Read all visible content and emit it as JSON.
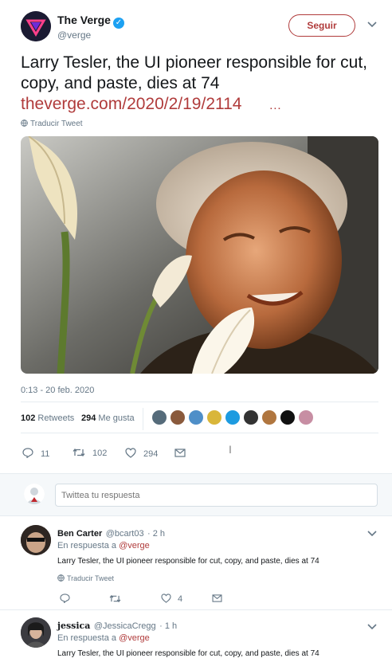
{
  "author": {
    "name": "The Verge",
    "handle": "@verge",
    "verified_mark": "✓",
    "follow_label": "Seguir",
    "menu_chevron": "⌄"
  },
  "tweet": {
    "text": "Larry Tesler, the UI pioneer responsible for cut, copy, and paste, dies at 74",
    "link": "theverge.com/2020/2/19/2114",
    "ellipsis": "…",
    "translate": "Traducir Tweet",
    "datetime": "0:13 - 20 feb. 2020",
    "retweets_count": "102",
    "retweets_label": "Retweets",
    "likes_count": "294",
    "likes_label": "Me gusta"
  },
  "actions": {
    "reply_count": "11",
    "retweet_count": "102",
    "like_count": "294"
  },
  "reply_box": {
    "placeholder": "Twittea tu respuesta"
  },
  "replies": [
    {
      "name": "Ben Carter",
      "handle": "@bcart03",
      "time": "· 2 h",
      "in_reply_prefix": "En respuesta a",
      "in_reply_to": "@verge",
      "text": "Larry Tesler, the UI pioneer responsible for cut, copy, and paste, dies at 74",
      "translate": "Traducir Tweet",
      "like_count": "4"
    },
    {
      "name": "jessica",
      "handle": "@JessicaCregg",
      "time": "· 1 h",
      "in_reply_prefix": "En respuesta a",
      "in_reply_to": "@verge",
      "text": "Larry Tesler, the UI pioneer responsible for cut, copy, and paste, dies at 74"
    }
  ],
  "colors": {
    "accent": "#b03b3b",
    "verified": "#1da1f2",
    "muted": "#657786",
    "divider": "#e6ecf0"
  },
  "icons": {
    "reply": "reply-icon",
    "retweet": "retweet-icon",
    "like": "heart-icon",
    "dm": "envelope-icon",
    "globe": "globe-icon"
  }
}
